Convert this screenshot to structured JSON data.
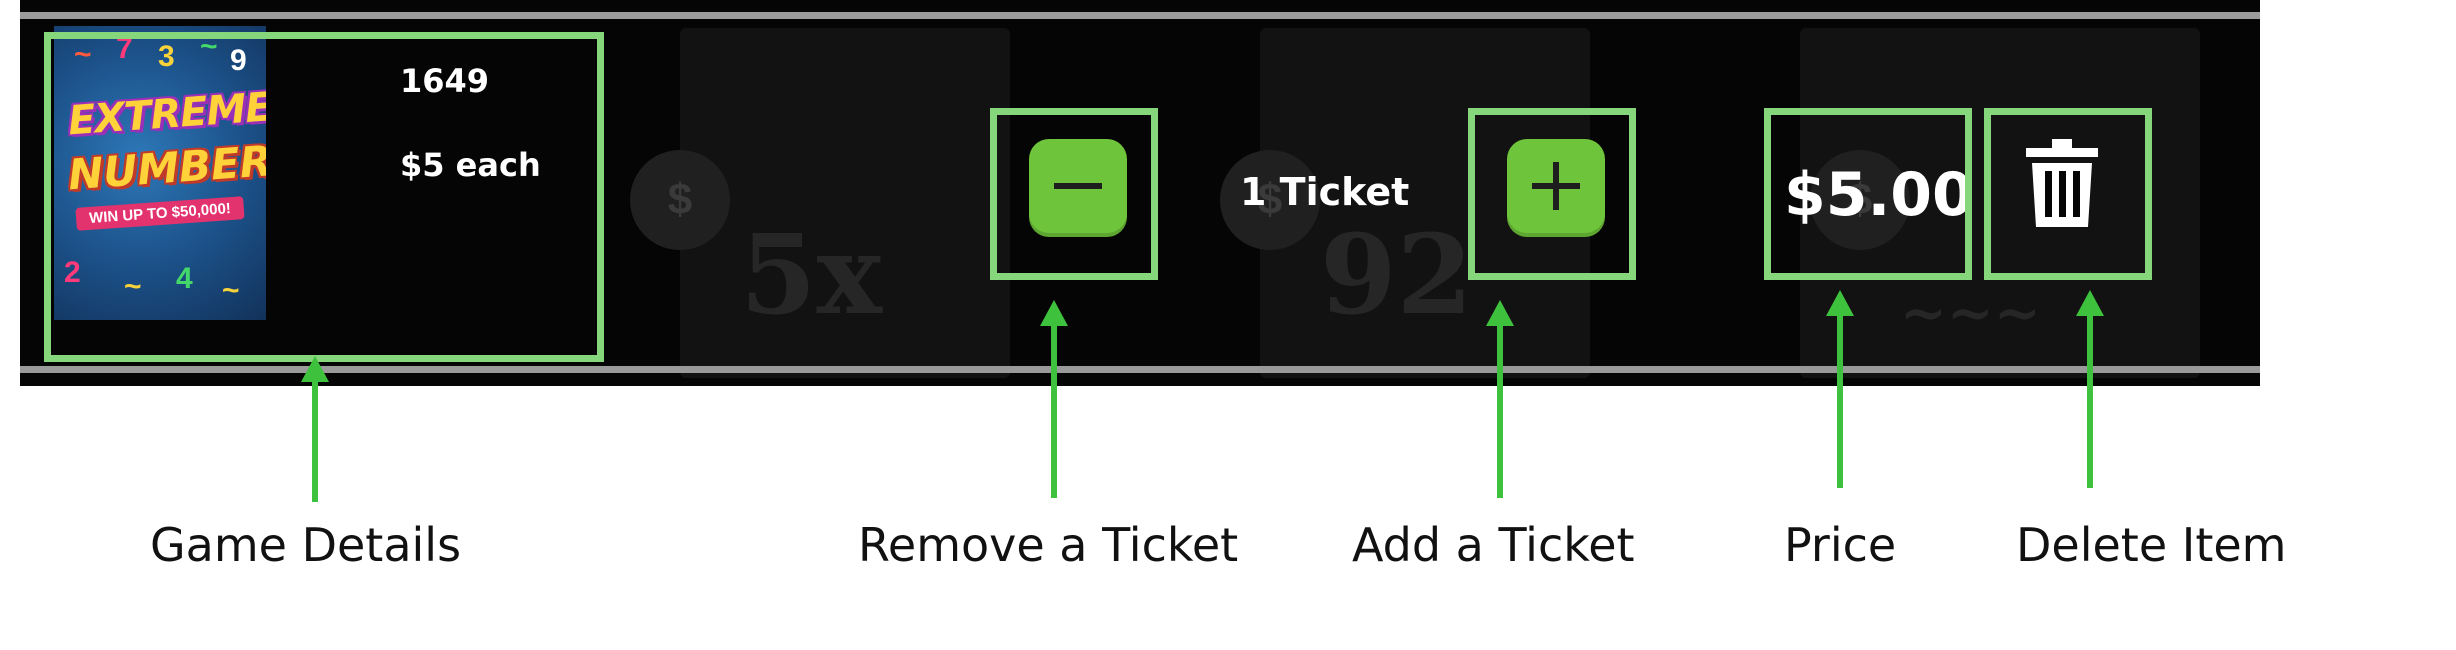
{
  "item": {
    "game_number": "1649",
    "price_each": "$5 each",
    "game_art": {
      "line1": "EXTREME",
      "line2": "NUMBERS",
      "tagline": "WIN UP TO $50,000!"
    },
    "quantity_label": "1 Ticket",
    "total_price": "$5.00"
  },
  "icons": {
    "decrease": "minus-icon",
    "increase": "plus-icon",
    "delete": "trash-icon"
  },
  "colors": {
    "highlight": "#86d67c",
    "arrow": "#3ec13c",
    "button_green": "#6ec43a",
    "bar_background": "#050505"
  },
  "annotations": [
    {
      "key": "game_details",
      "label": "Game Details"
    },
    {
      "key": "remove_ticket",
      "label": "Remove a Ticket"
    },
    {
      "key": "add_ticket",
      "label": "Add a Ticket"
    },
    {
      "key": "price",
      "label": "Price"
    },
    {
      "key": "delete_item",
      "label": "Delete Item"
    }
  ]
}
